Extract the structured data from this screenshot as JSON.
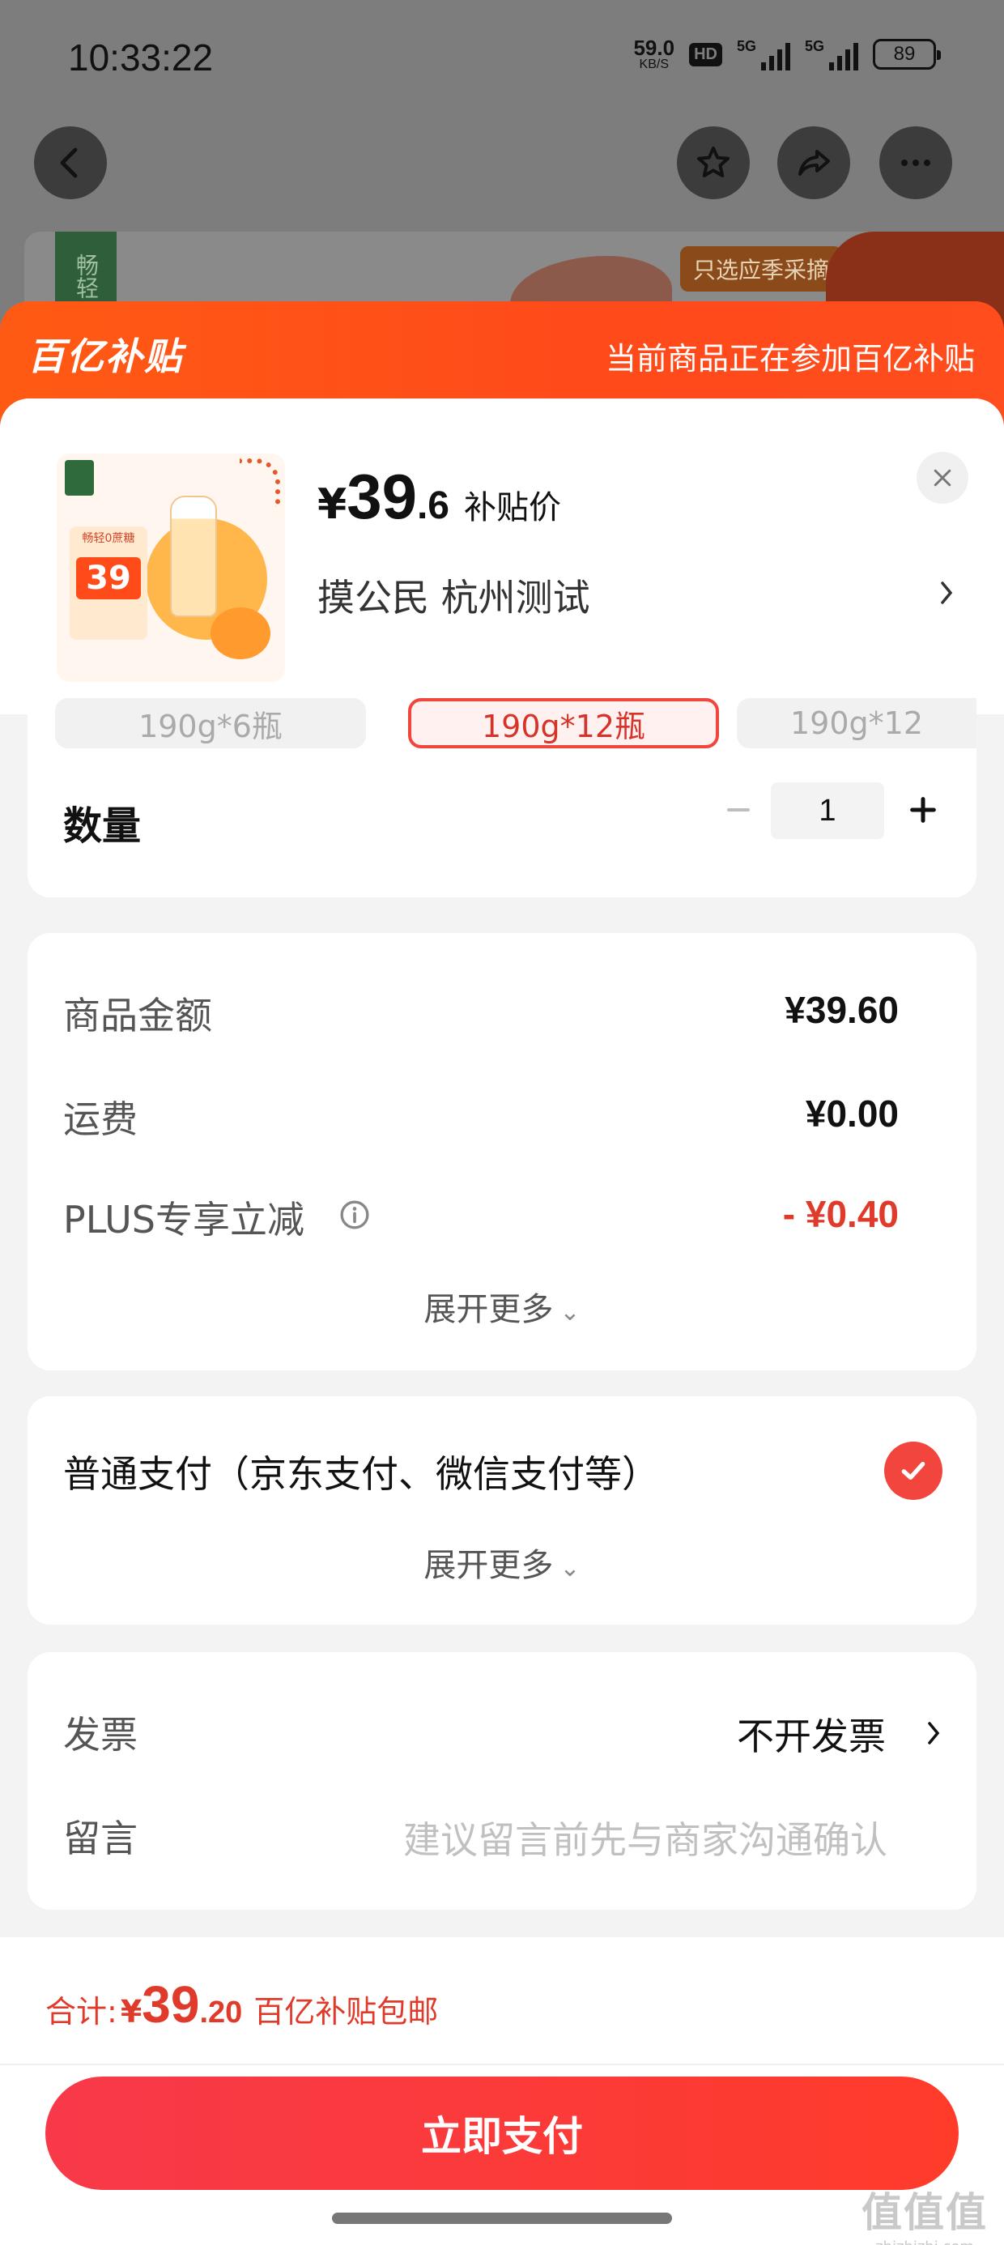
{
  "status_bar": {
    "time": "10:33:22",
    "net_speed": "59.0",
    "net_unit": "KB/S",
    "hd": "HD",
    "signal1": "5G",
    "signal2": "5G",
    "battery": "89"
  },
  "banner": {
    "logo_text": "畅轻",
    "tag_text": "只选应季采摘"
  },
  "subsidy": {
    "logo": "百亿补贴",
    "note": "当前商品正在参加百亿补贴"
  },
  "product": {
    "currency": "¥",
    "price_int": "39",
    "price_dec": ".6",
    "price_label": "补贴价",
    "spec": "摸公民  杭州测试",
    "image_tag_line": "畅轻0蔗糖",
    "image_price": "39"
  },
  "options": [
    "190g*6瓶",
    "190g*12瓶",
    "190g*12"
  ],
  "quantity": {
    "label": "数量",
    "value": "1"
  },
  "fees": {
    "items": [
      {
        "label": "商品金额",
        "value": "¥39.60"
      },
      {
        "label": "运费",
        "value": "¥0.00"
      },
      {
        "label": "PLUS专享立减",
        "value": "- ¥0.40"
      }
    ],
    "expand_label": "展开更多"
  },
  "payment": {
    "method": "普通支付（京东支付、微信支付等）",
    "expand_label": "展开更多"
  },
  "misc": {
    "invoice_label": "发票",
    "invoice_value": "不开发票",
    "note_label": "留言",
    "note_placeholder": "建议留言前先与商家沟通确认"
  },
  "bottom": {
    "total_label": "合计:",
    "currency": "¥",
    "total_int": "39",
    "total_dec": ".20",
    "shipping_note": "百亿补贴包邮",
    "pay_button": "立即支付"
  },
  "watermark": {
    "big": "值值值",
    "small": "zhizhizhi.com"
  },
  "colors": {
    "accent_red": "#e03a2b",
    "header_orange": "#ff5014",
    "pay_button": "#f7394a"
  }
}
